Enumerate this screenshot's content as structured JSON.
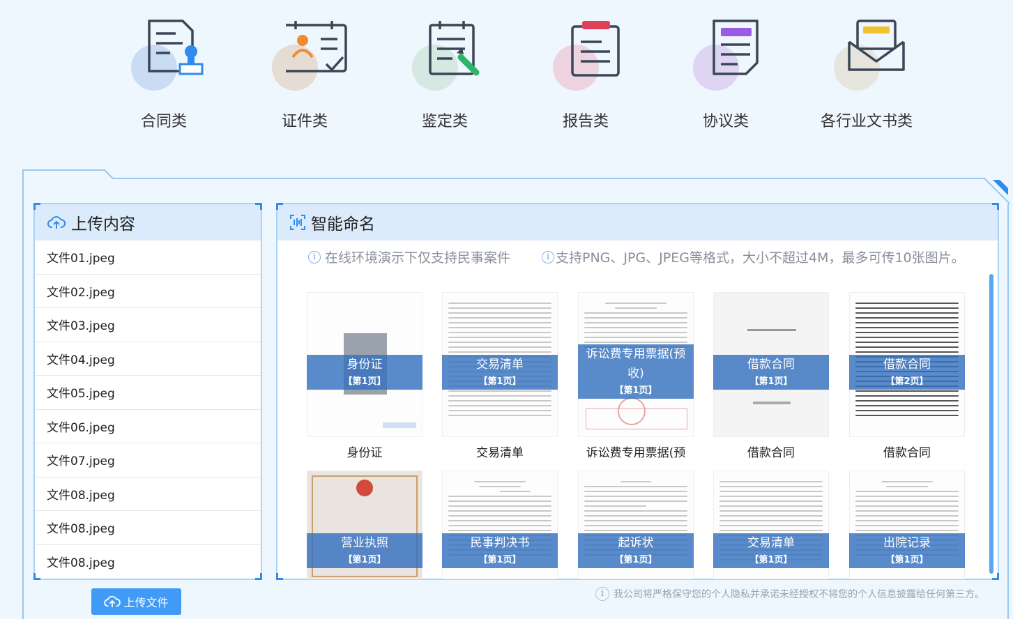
{
  "categories": [
    {
      "label": "合同类",
      "icon": "contract-icon",
      "circle_color": "#c9dcf3"
    },
    {
      "label": "证件类",
      "icon": "certificate-icon",
      "circle_color": "#e5dcd4"
    },
    {
      "label": "鉴定类",
      "icon": "appraisal-icon",
      "circle_color": "#d6e8e2"
    },
    {
      "label": "报告类",
      "icon": "report-icon",
      "circle_color": "#ecd3df"
    },
    {
      "label": "协议类",
      "icon": "agreement-icon",
      "circle_color": "#ded5f2"
    },
    {
      "label": "各行业文书类",
      "icon": "envelope-icon",
      "circle_color": "#e6e5de"
    }
  ],
  "upload_panel": {
    "title": "上传内容",
    "files": [
      "文件01.jpeg",
      "文件02.jpeg",
      "文件03.jpeg",
      "文件04.jpeg",
      "文件05.jpeg",
      "文件06.jpeg",
      "文件07.jpeg",
      "文件08.jpeg",
      "文件08.jpeg",
      "文件08.jpeg"
    ],
    "button_label": "上传文件"
  },
  "naming_panel": {
    "title": "智能命名",
    "notice_1": "在线环境演示下仅支持民事案件",
    "notice_2": "支持PNG、JPG、JPEG等格式，大小不超过4M，最多可传10张图片。",
    "documents": [
      {
        "name": "身份证",
        "page": "【第1页】",
        "caption": "身份证"
      },
      {
        "name": "交易清单",
        "page": "【第1页】",
        "caption": "交易清单"
      },
      {
        "name": "诉讼费专用票据(预收)",
        "page": "【第1页】",
        "caption": "诉讼费专用票据(预"
      },
      {
        "name": "借款合同",
        "page": "【第1页】",
        "caption": "借款合同"
      },
      {
        "name": "借款合同",
        "page": "【第2页】",
        "caption": "借款合同"
      },
      {
        "name": "营业执照",
        "page": "【第1页】",
        "caption": ""
      },
      {
        "name": "民事判决书",
        "page": "【第1页】",
        "caption": ""
      },
      {
        "name": "起诉状",
        "page": "【第1页】",
        "caption": ""
      },
      {
        "name": "交易清单",
        "page": "【第1页】",
        "caption": ""
      },
      {
        "name": "出院记录",
        "page": "【第1页】",
        "caption": ""
      }
    ]
  },
  "privacy_notice": "我公司将严格保守您的个人隐私并承诺未经授权不将您的个人信息披露给任何第三方。",
  "colors": {
    "accent": "#3f9bf5",
    "overlay": "#3470be",
    "panel_header": "#dcebfb"
  }
}
